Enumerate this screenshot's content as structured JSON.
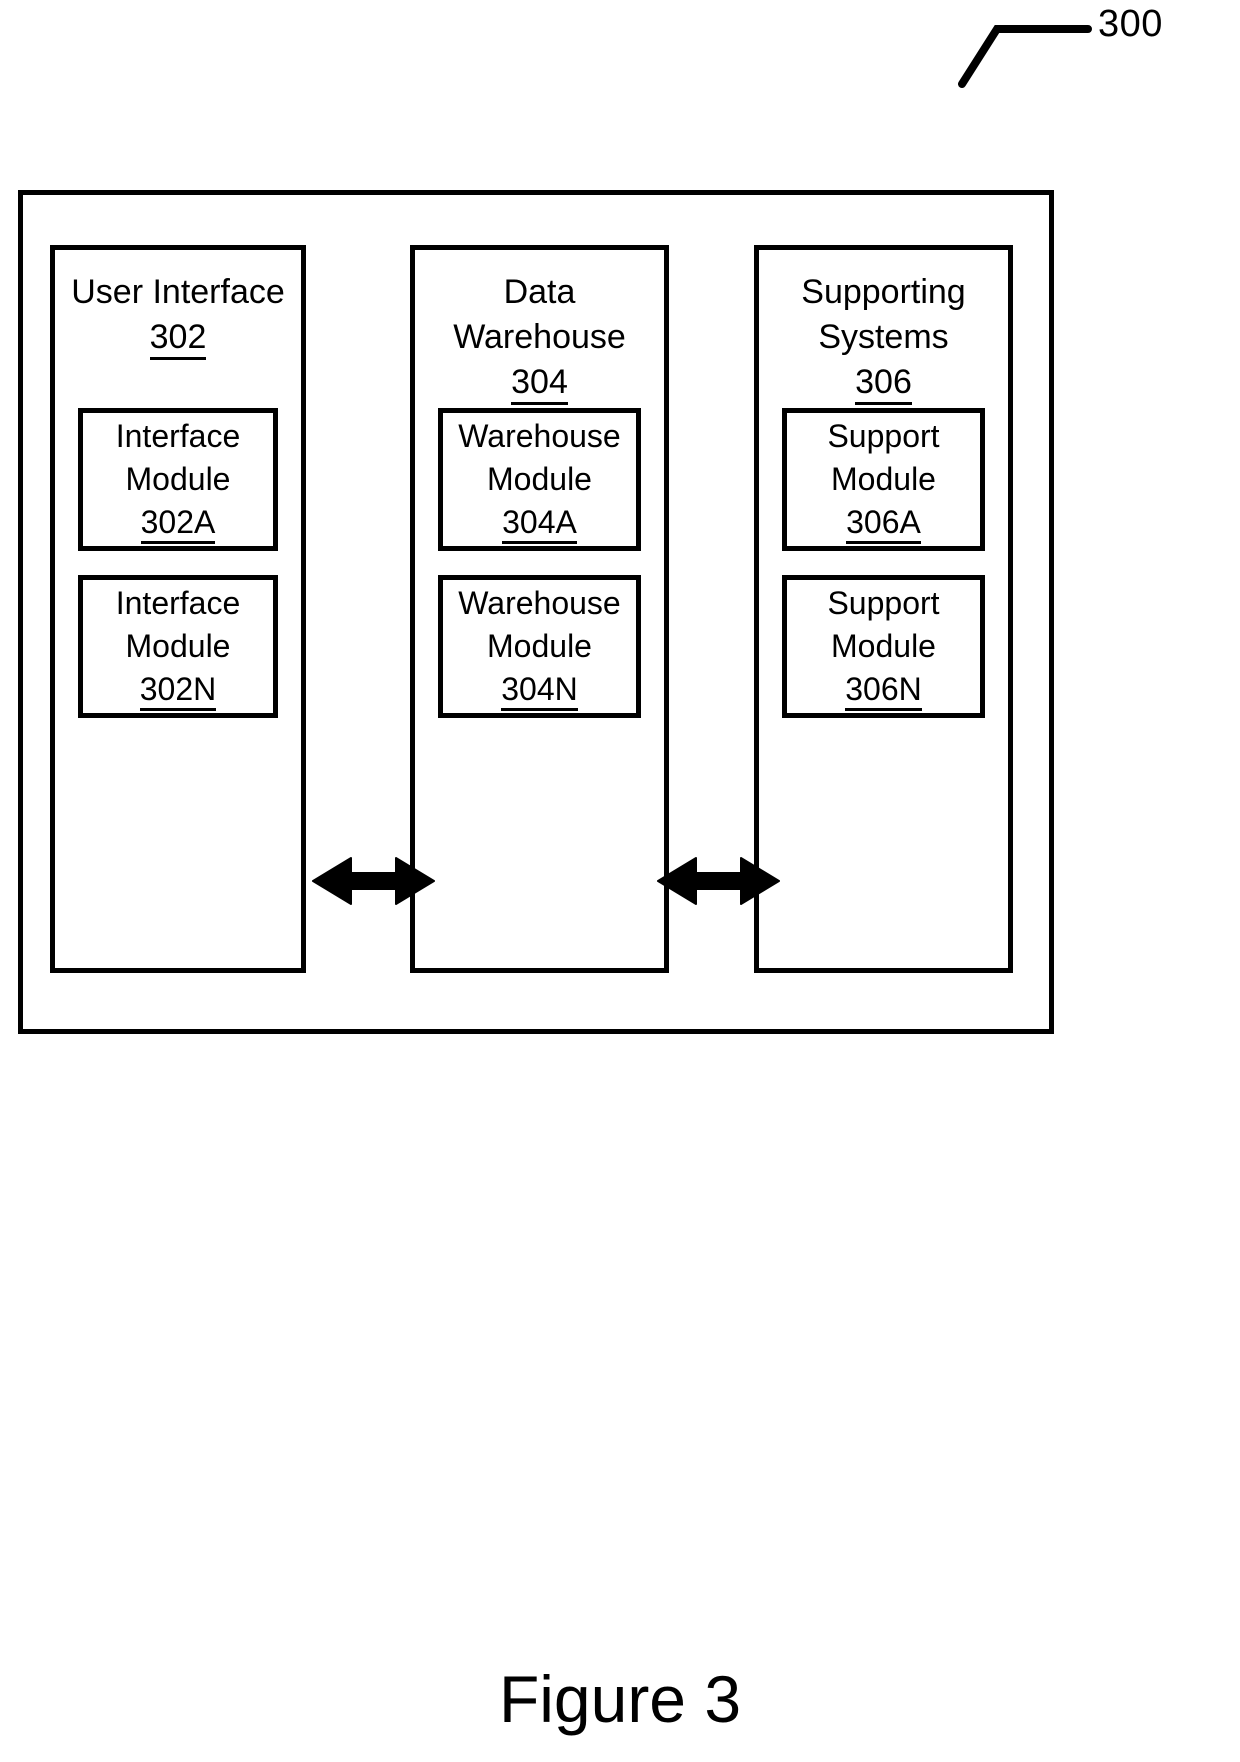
{
  "figure": {
    "reference_number": "300",
    "caption": "Figure 3"
  },
  "columns": [
    {
      "title": "User Interface",
      "ref": "302",
      "modules": [
        {
          "title": "Interface\nModule",
          "ref": "302A"
        },
        {
          "title": "Interface\nModule",
          "ref": "302N"
        }
      ]
    },
    {
      "title": "Data\nWarehouse",
      "ref": "304",
      "modules": [
        {
          "title": "Warehouse\nModule",
          "ref": "304A"
        },
        {
          "title": "Warehouse\nModule",
          "ref": "304N"
        }
      ]
    },
    {
      "title": "Supporting\nSystems",
      "ref": "306",
      "modules": [
        {
          "title": "Support\nModule",
          "ref": "306A"
        },
        {
          "title": "Support\nModule",
          "ref": "306N"
        }
      ]
    }
  ],
  "connectors": [
    {
      "name": "user-interface-to-data-warehouse",
      "type": "bidirectional-arrow"
    },
    {
      "name": "data-warehouse-to-supporting-systems",
      "type": "bidirectional-arrow"
    }
  ],
  "style": {
    "stroke": "#000000",
    "background": "#ffffff"
  }
}
